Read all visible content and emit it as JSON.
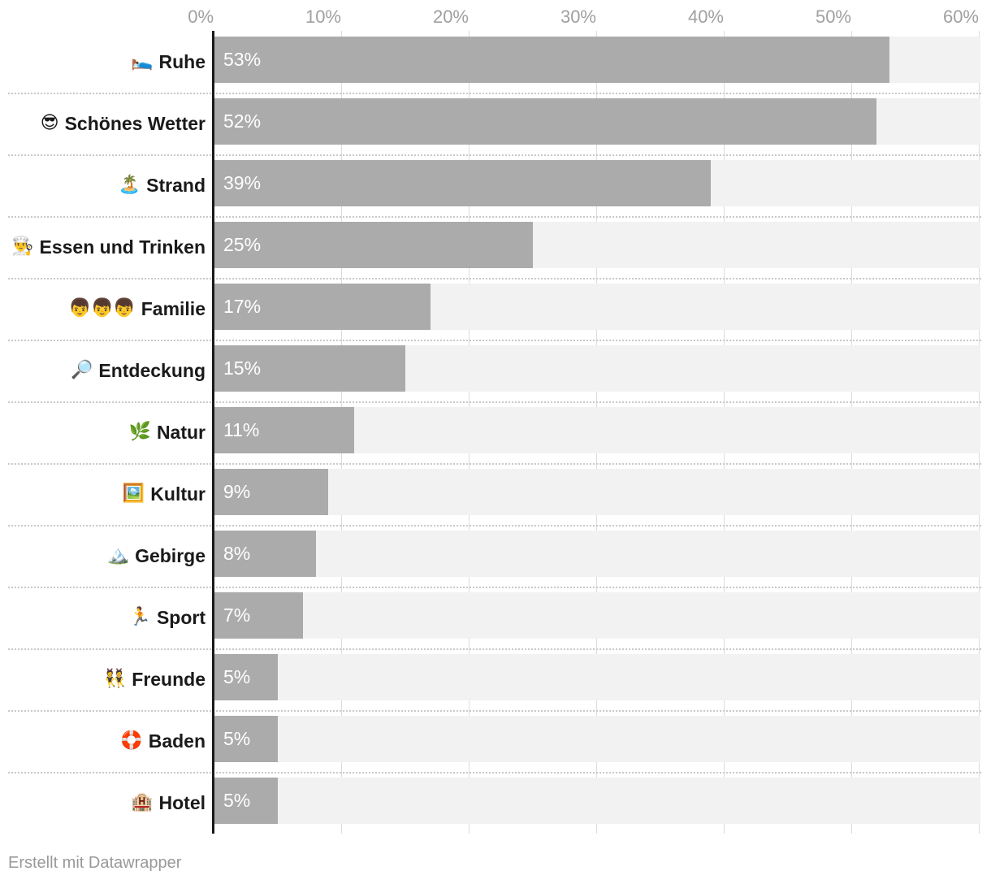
{
  "footer": {
    "credit": "Erstellt mit Datawrapper"
  },
  "colors": {
    "bar": "#ababab",
    "track": "#f2f2f2",
    "zero_axis": "#1a1a1a",
    "gridline": "#dcdcdc",
    "row_separator": "#c9c9c9",
    "tick_label": "#a0a0a0",
    "category_label": "#1a1a1a",
    "value_label": "#ffffff",
    "footer": "#999999",
    "background": "#ffffff"
  },
  "chart_data": {
    "type": "bar",
    "orientation": "horizontal",
    "title": "",
    "subtitle": "",
    "xlabel": "",
    "ylabel": "",
    "xlim": [
      0,
      60
    ],
    "grid": true,
    "legend": "none",
    "axis_ticks": [
      "0%",
      "10%",
      "20%",
      "30%",
      "40%",
      "50%",
      "60%"
    ],
    "axis_tick_values": [
      0,
      10,
      20,
      30,
      40,
      50,
      60
    ],
    "axis_position": "top",
    "value_suffix": "%",
    "categories": [
      "Ruhe",
      "Schönes Wetter",
      "Strand",
      "Essen und Trinken",
      "Familie",
      "Entdeckung",
      "Natur",
      "Kultur",
      "Gebirge",
      "Sport",
      "Freunde",
      "Baden",
      "Hotel"
    ],
    "values": [
      53,
      52,
      39,
      25,
      17,
      15,
      11,
      9,
      8,
      7,
      5,
      5,
      5
    ],
    "value_labels": [
      "53%",
      "52%",
      "39%",
      "25%",
      "17%",
      "15%",
      "11%",
      "9%",
      "8%",
      "7%",
      "5%",
      "5%",
      "5%"
    ],
    "category_emojis": [
      "🛌",
      "😎",
      "🏝️",
      "👨‍🍳",
      "👦👦👦",
      "🔎",
      "🌿",
      "🖼️",
      "🏔️",
      "🏃",
      "👯",
      "🛟",
      "🏨"
    ],
    "category_emoji_names": [
      "person-in-bed-icon",
      "smiling-face-with-sunglasses-icon",
      "desert-island-icon",
      "cook-icon",
      "family-people-icon",
      "magnifying-glass-icon",
      "herb-leaf-icon",
      "framed-picture-icon",
      "snow-capped-mountain-icon",
      "runner-icon",
      "people-with-bunny-ears-icon",
      "ring-buoy-icon",
      "hotel-icon"
    ],
    "rows": [
      {
        "label": "Ruhe",
        "emoji": "🛌",
        "value": 53,
        "value_label": "53%"
      },
      {
        "label": "Schönes Wetter",
        "emoji": "😎",
        "value": 52,
        "value_label": "52%"
      },
      {
        "label": "Strand",
        "emoji": "🏝️",
        "value": 39,
        "value_label": "39%"
      },
      {
        "label": "Essen und Trinken",
        "emoji": "👨‍🍳",
        "value": 25,
        "value_label": "25%"
      },
      {
        "label": "Familie",
        "emoji": "👦👦👦",
        "value": 17,
        "value_label": "17%"
      },
      {
        "label": "Entdeckung",
        "emoji": "🔎",
        "value": 15,
        "value_label": "15%"
      },
      {
        "label": "Natur",
        "emoji": "🌿",
        "value": 11,
        "value_label": "11%"
      },
      {
        "label": "Kultur",
        "emoji": "🖼️",
        "value": 9,
        "value_label": "9%"
      },
      {
        "label": "Gebirge",
        "emoji": "🏔️",
        "value": 8,
        "value_label": "8%"
      },
      {
        "label": "Sport",
        "emoji": "🏃",
        "value": 7,
        "value_label": "7%"
      },
      {
        "label": "Freunde",
        "emoji": "👯",
        "value": 5,
        "value_label": "5%"
      },
      {
        "label": "Baden",
        "emoji": "🛟",
        "value": 5,
        "value_label": "5%"
      },
      {
        "label": "Hotel",
        "emoji": "🏨",
        "value": 5,
        "value_label": "5%"
      }
    ]
  }
}
